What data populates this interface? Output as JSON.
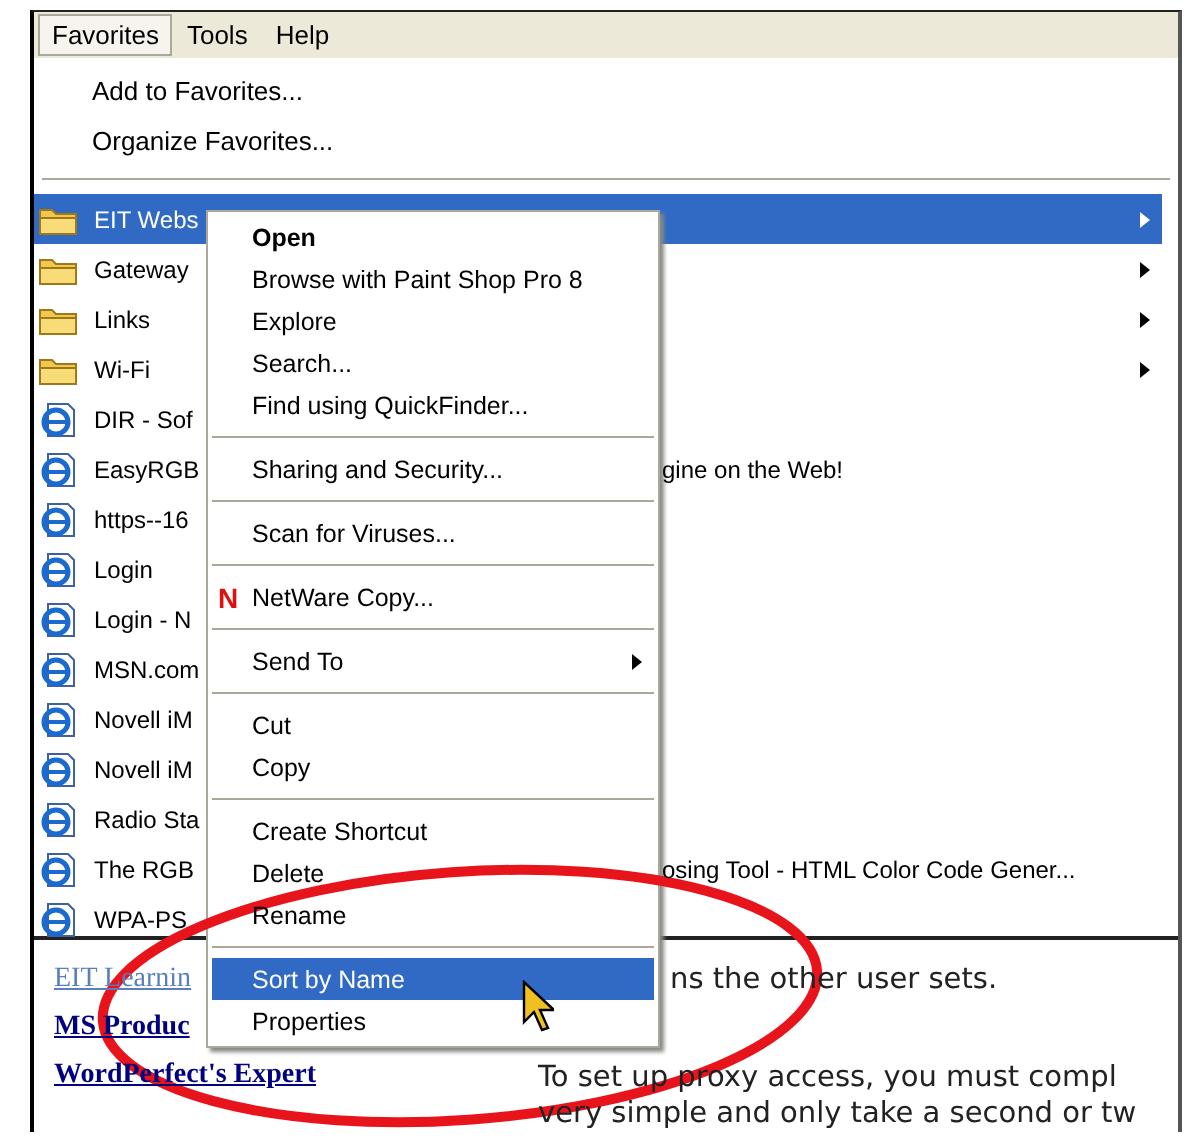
{
  "menubar": [
    {
      "label": "Favorites",
      "selected": true
    },
    {
      "label": "Tools",
      "selected": false
    },
    {
      "label": "Help",
      "selected": false
    }
  ],
  "favorites": {
    "top_items": [
      "Add to Favorites...",
      "Organize Favorites..."
    ],
    "items": [
      {
        "kind": "folder",
        "name": "EIT Webs",
        "submenu": true,
        "selected": true
      },
      {
        "kind": "folder",
        "name": "Gateway",
        "submenu": true,
        "selected": false
      },
      {
        "kind": "folder",
        "name": "Links",
        "submenu": true,
        "selected": false
      },
      {
        "kind": "folder",
        "name": "Wi-Fi",
        "submenu": true,
        "selected": false
      },
      {
        "kind": "page",
        "name": "DIR - Sof",
        "submenu": false,
        "selected": false
      },
      {
        "kind": "page",
        "name": "EasyRGB",
        "tail": "gine on the Web!",
        "submenu": false,
        "selected": false
      },
      {
        "kind": "page",
        "name": "https--16",
        "submenu": false,
        "selected": false
      },
      {
        "kind": "page",
        "name": "Login",
        "submenu": false,
        "selected": false
      },
      {
        "kind": "page",
        "name": "Login - N",
        "submenu": false,
        "selected": false
      },
      {
        "kind": "page",
        "name": "MSN.com",
        "submenu": false,
        "selected": false
      },
      {
        "kind": "page",
        "name": "Novell iM",
        "submenu": false,
        "selected": false
      },
      {
        "kind": "page",
        "name": "Novell iM",
        "submenu": false,
        "selected": false
      },
      {
        "kind": "page",
        "name": "Radio Sta",
        "submenu": false,
        "selected": false
      },
      {
        "kind": "page",
        "name": "The RGB",
        "tail": "osing Tool - HTML Color Code Gener...",
        "submenu": false,
        "selected": false
      },
      {
        "kind": "page",
        "name": "WPA-PS",
        "submenu": false,
        "selected": false
      }
    ]
  },
  "context_menu": [
    {
      "kind": "item",
      "label": "Open",
      "bold": true,
      "selected": false
    },
    {
      "kind": "item",
      "label": "Browse with Paint Shop Pro 8",
      "selected": false
    },
    {
      "kind": "item",
      "label": "Explore",
      "selected": false
    },
    {
      "kind": "item",
      "label": "Search...",
      "selected": false
    },
    {
      "kind": "item",
      "label": "Find using QuickFinder...",
      "selected": false
    },
    {
      "kind": "separator"
    },
    {
      "kind": "item",
      "label": "Sharing and Security...",
      "selected": false
    },
    {
      "kind": "separator"
    },
    {
      "kind": "item",
      "label": "Scan for Viruses...",
      "selected": false
    },
    {
      "kind": "separator"
    },
    {
      "kind": "item",
      "label": "NetWare Copy...",
      "icon": "N",
      "selected": false
    },
    {
      "kind": "separator"
    },
    {
      "kind": "item",
      "label": "Send To",
      "submenu": true,
      "selected": false
    },
    {
      "kind": "separator"
    },
    {
      "kind": "item",
      "label": "Cut",
      "selected": false
    },
    {
      "kind": "item",
      "label": "Copy",
      "selected": false
    },
    {
      "kind": "separator"
    },
    {
      "kind": "item",
      "label": "Create Shortcut",
      "selected": false
    },
    {
      "kind": "item",
      "label": "Delete",
      "selected": false
    },
    {
      "kind": "item",
      "label": "Rename",
      "selected": false
    },
    {
      "kind": "separator"
    },
    {
      "kind": "item",
      "label": "Sort by Name",
      "selected": true
    },
    {
      "kind": "item",
      "label": "Properties",
      "selected": false
    }
  ],
  "page": {
    "links": [
      "EIT Learnin",
      "MS Produc",
      "WordPerfect's Expert"
    ],
    "paragraphs": [
      [
        "ns the other user sets."
      ],
      [
        "To set up proxy access, you must compl",
        "very simple and only take a second or tw"
      ]
    ]
  }
}
